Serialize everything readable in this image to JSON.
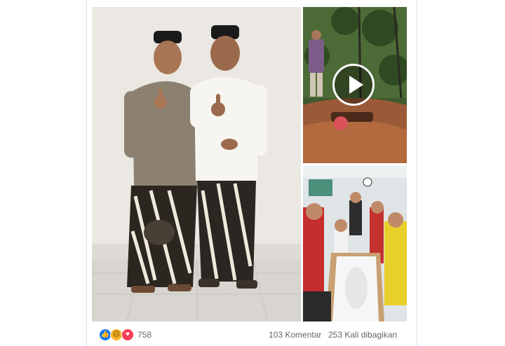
{
  "post": {
    "reactions": {
      "icons": [
        "like-icon",
        "sad-icon",
        "love-icon"
      ],
      "count": "758"
    },
    "comments_label": "103 Komentar",
    "shares_label": "253 Kali dibagikan"
  },
  "colors": {
    "like": "#1877f2",
    "sad": "#f7b125",
    "love": "#f33e58",
    "meta_text": "#606770",
    "card_border": "#dddfe2"
  }
}
